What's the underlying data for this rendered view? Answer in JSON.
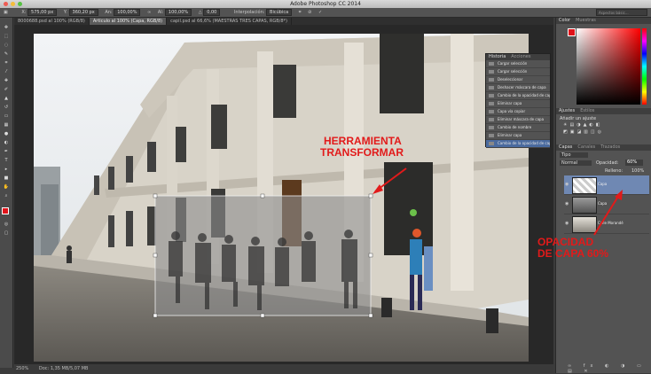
{
  "window": {
    "title": "Adobe Photoshop CC 2014"
  },
  "options_bar": {
    "x_label": "X:",
    "x_value": "575,00 px",
    "y_label": "Y:",
    "y_value": "360,20 px",
    "w_label": "An:",
    "w_value": "100,00%",
    "h_label": "Al:",
    "h_value": "100,00%",
    "angle_value": "0,00",
    "interpolation_label": "Interpolación:",
    "interpolation_value": "Bicúbica",
    "search_placeholder": "Aspectos básic..."
  },
  "doc_tabs": [
    {
      "label": "8000688.psd al 100% (RGB/8)"
    },
    {
      "label": "Articulo al 100% (Capa, RGB/8)"
    },
    {
      "label": "capil.psd al 66,6% (MAESTRAS TRES CAPAS, RGB/8*)"
    }
  ],
  "status_bar": {
    "zoom": "250%",
    "doc": "Doc: 1,35 MB/5,07 MB"
  },
  "history_panel": {
    "tabs": [
      "Historia",
      "Acciones"
    ],
    "items": [
      "Cargar selección",
      "Cargar selección",
      "Deseleccionar",
      "Deshacer máscara de capa",
      "Cambio de la opacidad de capa",
      "Eliminar capa",
      "Capa vía copiar",
      "Eliminar máscara de capa",
      "Cambio de nombre",
      "Eliminar capa",
      "Cambio de la opacidad de capa"
    ]
  },
  "color_panel": {
    "tabs": [
      "Color",
      "Muestras"
    ],
    "foreground": "#e0131a",
    "background": "#ffffff"
  },
  "adjustments_panel": {
    "tabs": [
      "Ajustes",
      "Estilos"
    ],
    "title": "Añadir un ajuste"
  },
  "layers_panel": {
    "tabs": [
      "Capas",
      "Canales",
      "Trazados"
    ],
    "kind_label": "Tipo",
    "blend_mode": "Normal",
    "opacity_label": "Opacidad:",
    "opacity_value": "60%",
    "fill_label": "Relleno:",
    "fill_value": "100%",
    "layers": [
      {
        "name": "Capa"
      },
      {
        "name": "Capa"
      },
      {
        "name": "Calle Morandé"
      }
    ]
  },
  "annotations": {
    "transform_line1": "HERRAMIENTA",
    "transform_line2": "TRANSFORMAR",
    "opacity_line1": "OPACIDAD",
    "opacity_line2": "DE CAPA 60%"
  },
  "colors": {
    "annotation": "#e21a1a",
    "selection": "#4a6a9e"
  }
}
